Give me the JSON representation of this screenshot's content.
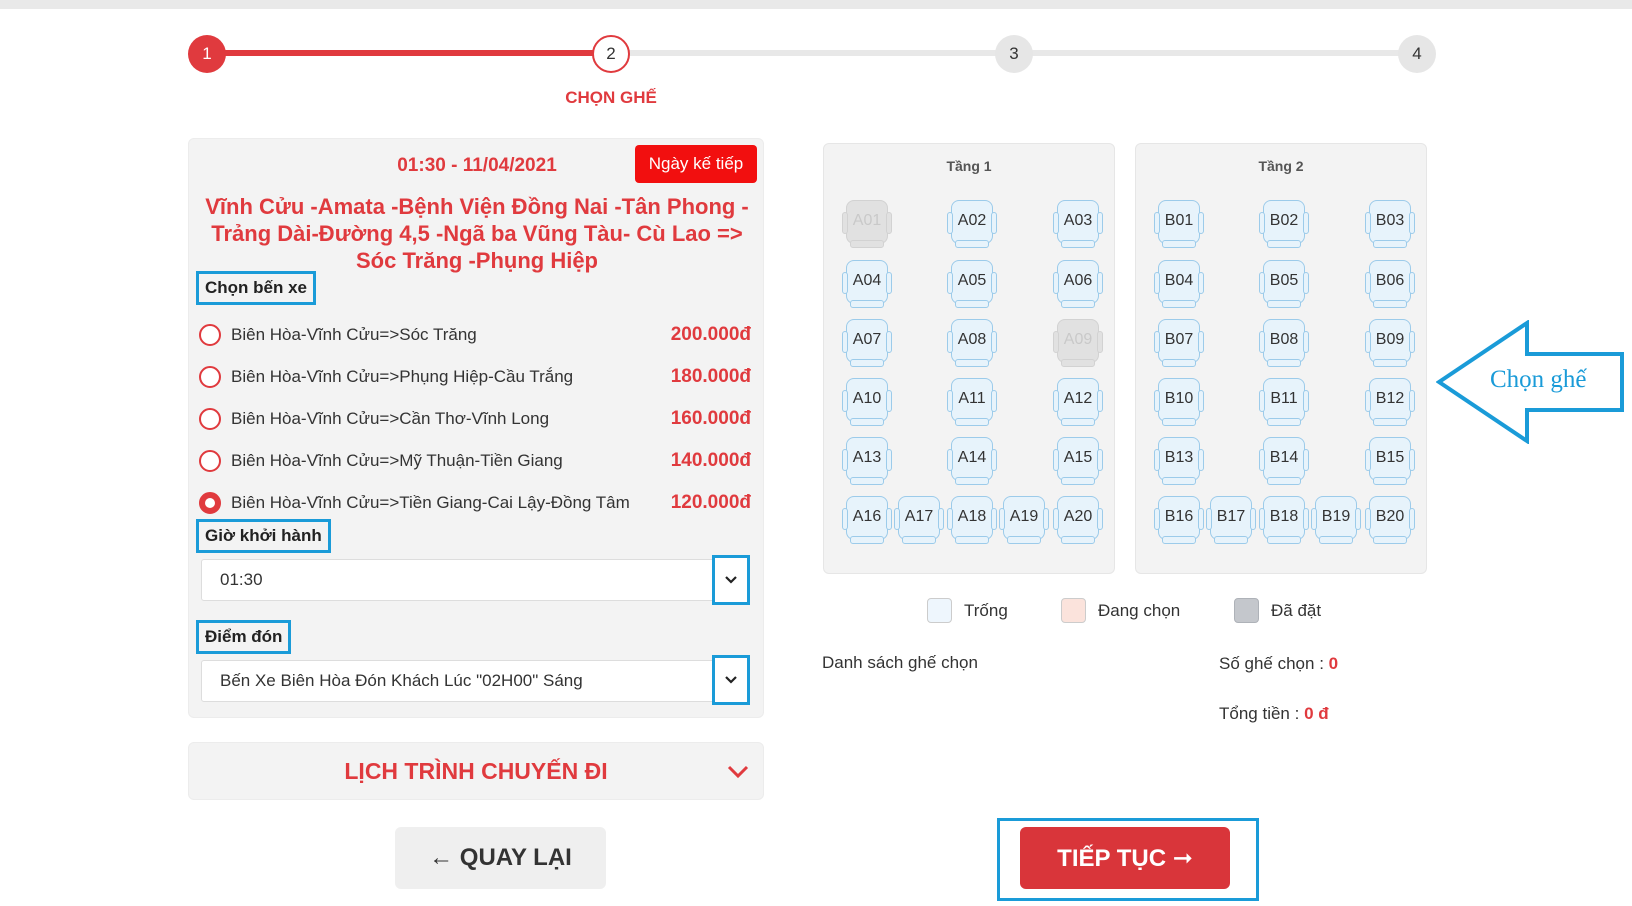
{
  "stepper": {
    "steps": [
      "1",
      "2",
      "3",
      "4"
    ],
    "current_label": "CHỌN GHẾ",
    "colors": {
      "active": "#e03a3e",
      "inactive": "#e6e6e6"
    }
  },
  "trip": {
    "time": "01:30 - 11/04/2021",
    "next_day_label": "Ngày kế tiếp",
    "route": "Vĩnh Cửu -Amata -Bệnh Viện Đồng Nai -Tân Phong - Trảng Dài-Đường 4,5 -Ngã ba Vũng Tàu- Cù Lao => Sóc Trăng -Phụng Hiệp"
  },
  "station_section": {
    "label": "Chọn bến xe",
    "items": [
      {
        "name": "Biên Hòa-Vĩnh Cửu=>Sóc Trăng",
        "price": "200.000đ",
        "selected": false
      },
      {
        "name": "Biên Hòa-Vĩnh Cửu=>Phụng Hiệp-Cầu Trắng",
        "price": "180.000đ",
        "selected": false
      },
      {
        "name": "Biên Hòa-Vĩnh Cửu=>Cần Thơ-Vĩnh Long",
        "price": "160.000đ",
        "selected": false
      },
      {
        "name": "Biên Hòa-Vĩnh Cửu=>Mỹ Thuận-Tiền Giang",
        "price": "140.000đ",
        "selected": false
      },
      {
        "name": "Biên Hòa-Vĩnh Cửu=>Tiền Giang-Cai Lậy-Đồng Tâm",
        "price": "120.000đ",
        "selected": true
      }
    ]
  },
  "departure": {
    "label": "Giờ khởi hành",
    "value": "01:30"
  },
  "pickup": {
    "label": "Điểm đón",
    "value": "Bến Xe Biên Hòa Đón Khách Lúc \"02H00\" Sáng"
  },
  "schedule": {
    "title": "LỊCH TRÌNH CHUYẾN ĐI"
  },
  "buttons": {
    "back": "← QUAY LẠI",
    "continue": "TIẾP TỤC ➞"
  },
  "decks": [
    {
      "title": "Tầng 1",
      "seats": [
        "A01",
        "A02",
        "A03",
        "A04",
        "A05",
        "A06",
        "A07",
        "A08",
        "A09",
        "A10",
        "A11",
        "A12",
        "A13",
        "A14",
        "A15",
        "A16",
        "A17",
        "A18",
        "A19",
        "A20"
      ],
      "booked": [
        "A01",
        "A09"
      ]
    },
    {
      "title": "Tầng 2",
      "seats": [
        "B01",
        "B02",
        "B03",
        "B04",
        "B05",
        "B06",
        "B07",
        "B08",
        "B09",
        "B10",
        "B11",
        "B12",
        "B13",
        "B14",
        "B15",
        "B16",
        "B17",
        "B18",
        "B19",
        "B20"
      ],
      "booked": []
    }
  ],
  "legend": [
    {
      "label": "Trống",
      "color": "#eef6fd"
    },
    {
      "label": "Đang chọn",
      "color": "#fbe3dc"
    },
    {
      "label": "Đã đặt",
      "color": "#c4c7cc"
    }
  ],
  "summary": {
    "selected_list_label": "Danh sách ghế chọn",
    "seat_count_label": "Số ghế chọn : ",
    "seat_count": "0",
    "total_label": "Tổng tiền : ",
    "total": "0 đ"
  },
  "annotation": {
    "text": "Chọn ghế"
  }
}
